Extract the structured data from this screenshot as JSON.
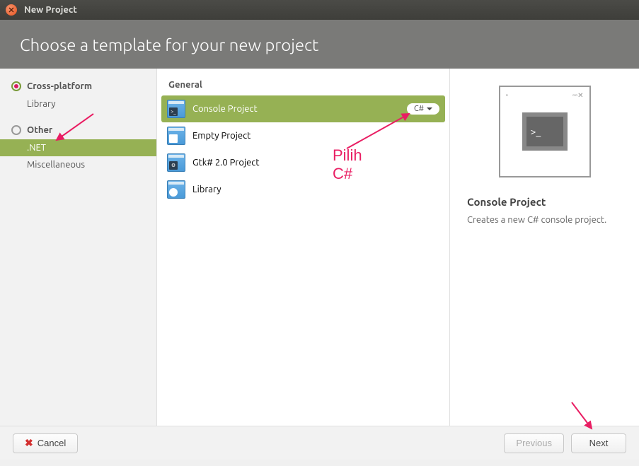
{
  "window": {
    "title": "New Project"
  },
  "header": {
    "title": "Choose a template for your new project"
  },
  "sidebar": {
    "categories": [
      {
        "label": "Cross-platform",
        "radio_style": "colored",
        "items": [
          {
            "label": "Library",
            "selected": false
          }
        ]
      },
      {
        "label": "Other",
        "radio_style": "plain",
        "items": [
          {
            "label": ".NET",
            "selected": true
          },
          {
            "label": "Miscellaneous",
            "selected": false
          }
        ]
      }
    ]
  },
  "templates": {
    "group_label": "General",
    "items": [
      {
        "label": "Console Project",
        "selected": true,
        "lang": "C#"
      },
      {
        "label": "Empty Project",
        "selected": false
      },
      {
        "label": "Gtk# 2.0 Project",
        "selected": false
      },
      {
        "label": "Library",
        "selected": false
      }
    ]
  },
  "detail": {
    "title": "Console Project",
    "description": "Creates a new C# console project."
  },
  "footer": {
    "cancel_label": "Cancel",
    "previous_label": "Previous",
    "next_label": "Next"
  },
  "annotations": {
    "lang_hint": "Pilih C#"
  }
}
